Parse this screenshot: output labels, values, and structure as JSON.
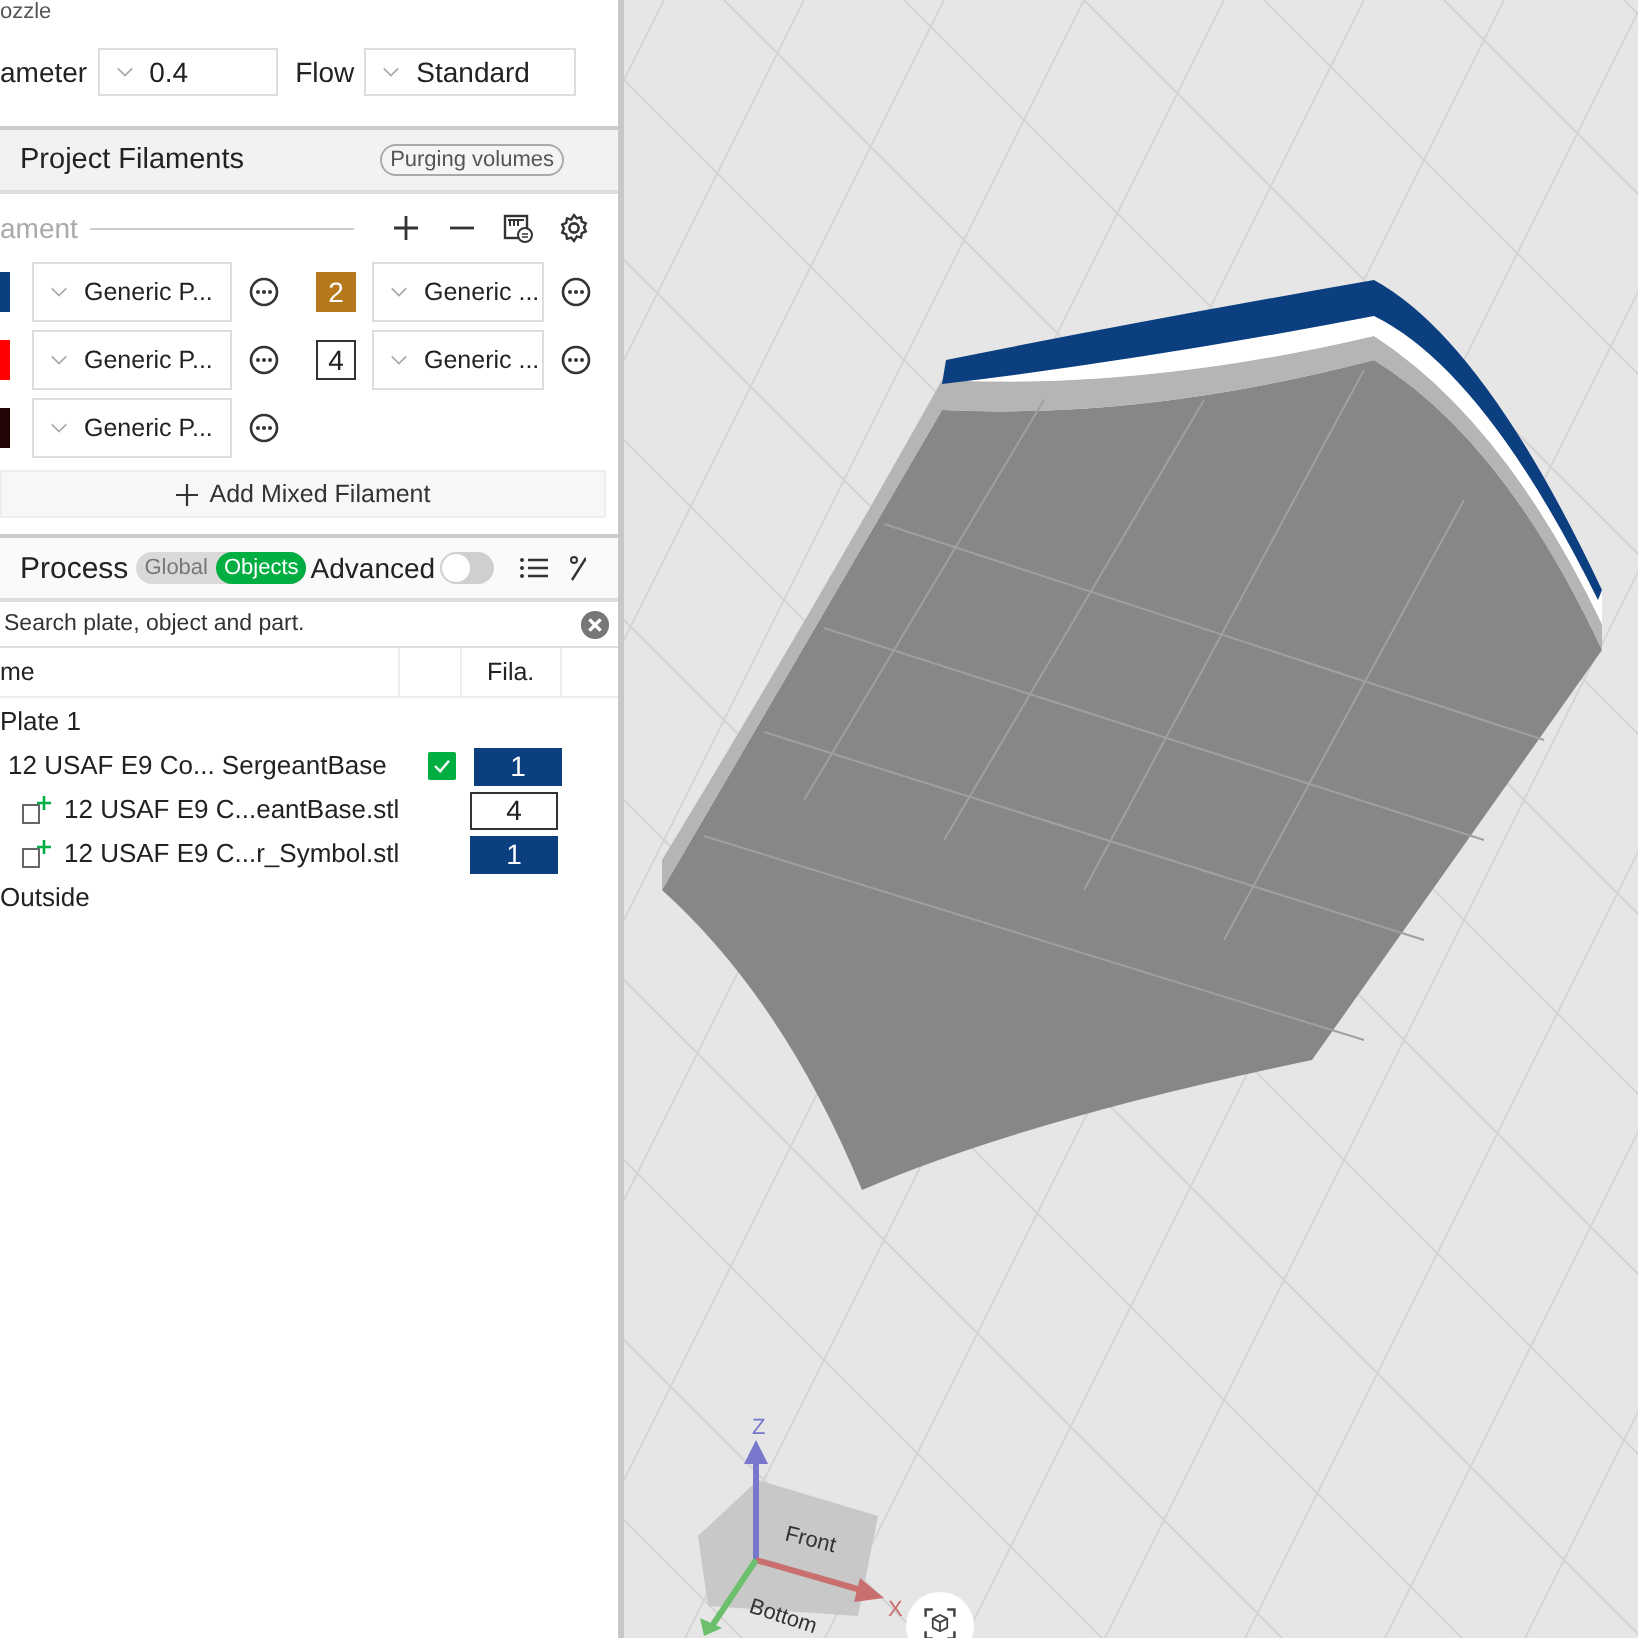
{
  "nozzle": {
    "title": "ozzle",
    "diameter_label": "ameter",
    "diameter": "0.4",
    "flow_label": "Flow",
    "flow": "Standard"
  },
  "project_filaments": {
    "title": "Project Filaments",
    "purging_button": "Purging volumes",
    "filament_label": "ament",
    "slots": [
      {
        "kind": "cut",
        "color": "#0b3f7f",
        "preset": "Generic P..."
      },
      {
        "kind": "badge",
        "number": "2",
        "color": "#b5781a",
        "preset": "Generic ..."
      },
      {
        "kind": "cut",
        "color": "#ff0000",
        "preset": "Generic P..."
      },
      {
        "kind": "badge",
        "number": "4",
        "color": "#ffffff",
        "preset": "Generic ..."
      },
      {
        "kind": "cut",
        "color": "#220505",
        "preset": "Generic P..."
      }
    ],
    "add_mixed": "Add Mixed Filament"
  },
  "process": {
    "title": "Process",
    "tabs": [
      {
        "label": "Global",
        "selected": false
      },
      {
        "label": "Objects",
        "selected": true
      }
    ],
    "advanced_label": "Advanced",
    "advanced_on": false
  },
  "search": {
    "placeholder": "Search plate, object and part."
  },
  "table": {
    "columns": [
      "me",
      "Fila."
    ],
    "rows": [
      {
        "kind": "plate",
        "name": "Plate 1",
        "children": [
          {
            "kind": "object",
            "name": "12 USAF E9 Co... SergeantBase",
            "checked": true,
            "filament": "1",
            "color": "#0b3f7f",
            "children": [
              {
                "kind": "part",
                "name": "12 USAF E9 C...eantBase.stl",
                "filament": "4",
                "color": "#ffffff"
              },
              {
                "kind": "part",
                "name": "12 USAF E9 C...r_Symbol.stl",
                "filament": "1",
                "color": "#0b3f7f"
              }
            ]
          }
        ]
      },
      {
        "kind": "plate",
        "name": "Outside",
        "children": []
      }
    ]
  },
  "viewport": {
    "gizmo": {
      "z": "Z",
      "x": "X",
      "front": "Front",
      "bottom": "Bottom"
    }
  }
}
